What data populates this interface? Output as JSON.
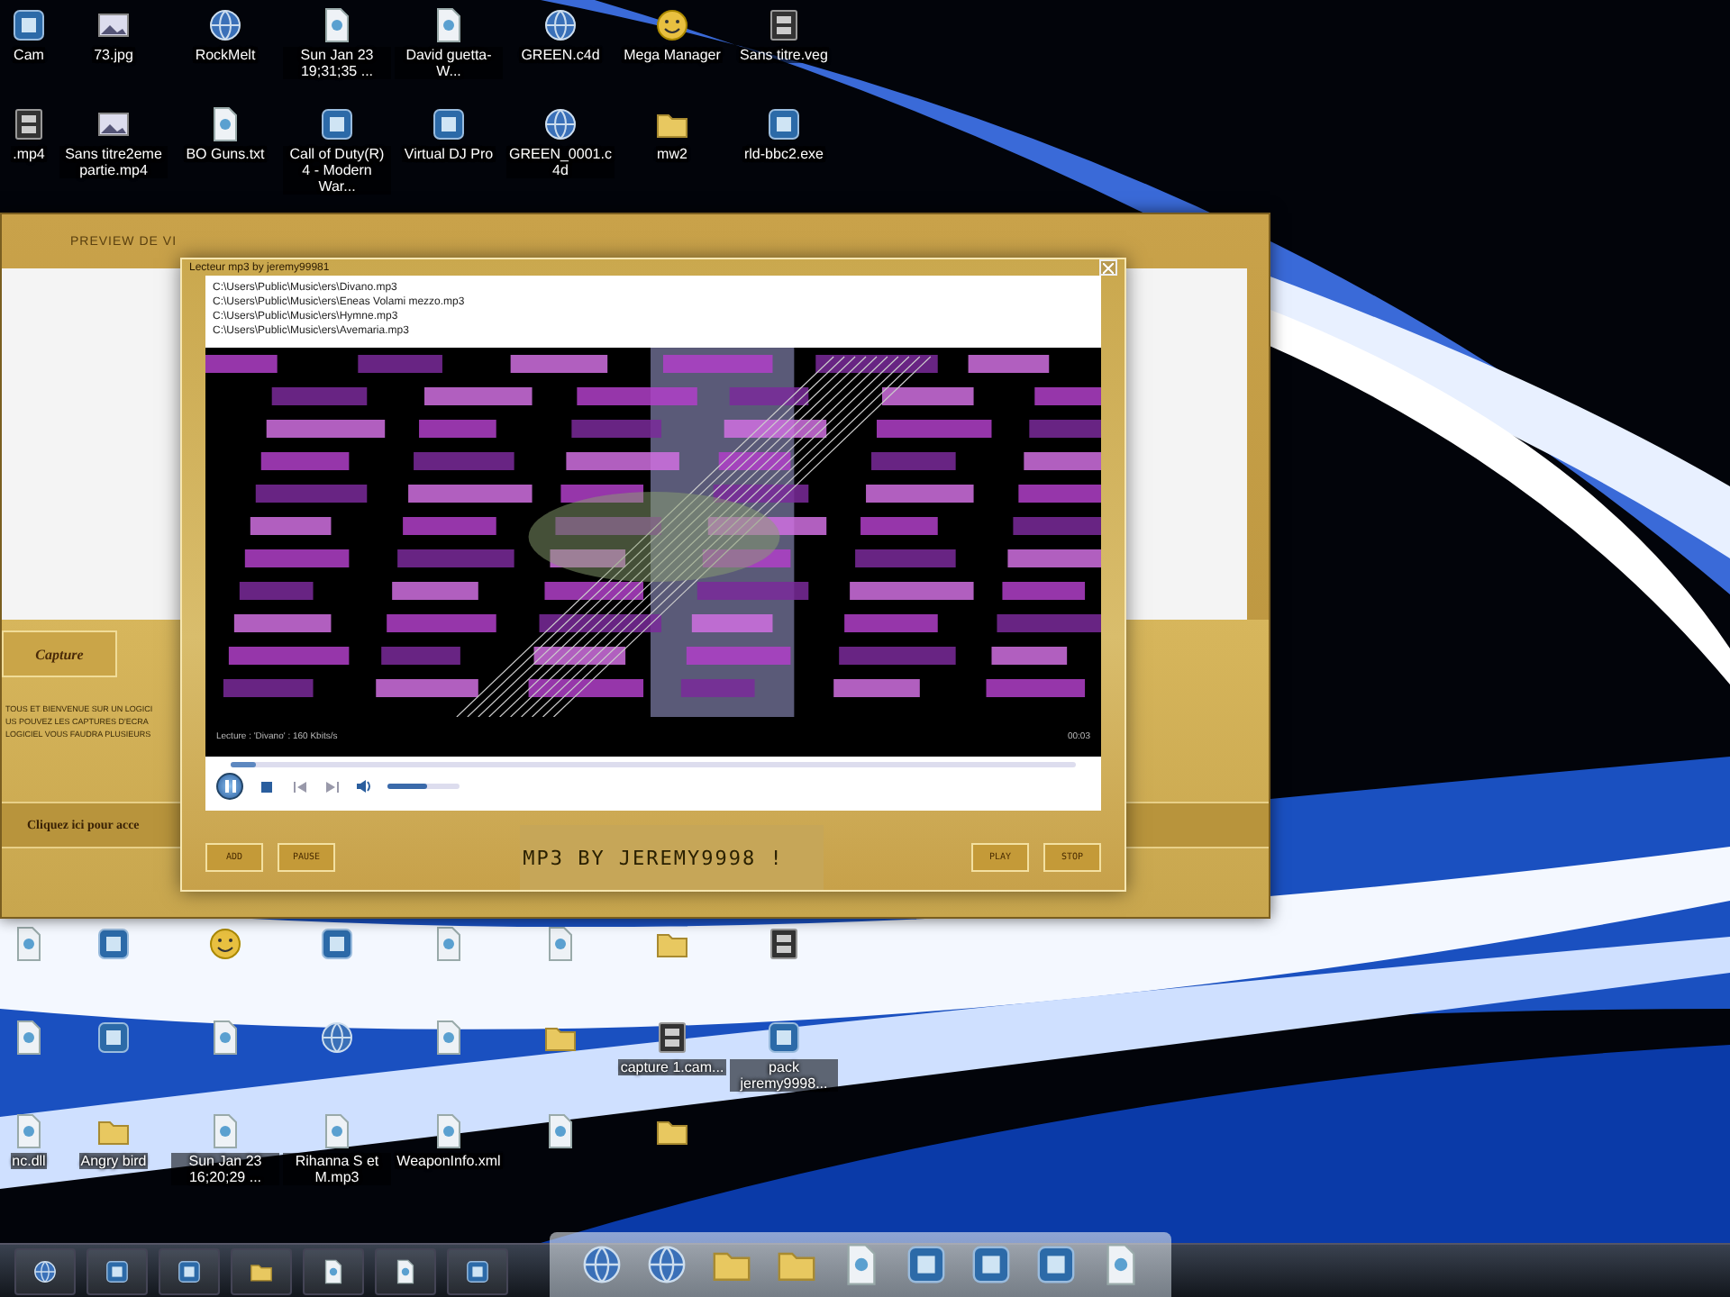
{
  "desktop": {
    "top_icons": [
      {
        "kind": "app",
        "label": "Cam"
      },
      {
        "kind": "image",
        "label": "73.jpg"
      },
      {
        "kind": "globe",
        "label": "RockMelt"
      },
      {
        "kind": "file",
        "label": "Sun Jan 23 19;31;35 ..."
      },
      {
        "kind": "file",
        "label": "David guetta-W..."
      },
      {
        "kind": "globe",
        "label": "GREEN.c4d"
      },
      {
        "kind": "smiley",
        "label": "Mega Manager"
      },
      {
        "kind": "film",
        "label": "Sans titre.veg"
      },
      {
        "kind": "film",
        "label": ".mp4"
      },
      {
        "kind": "image",
        "label": "Sans titre2eme partie.mp4"
      },
      {
        "kind": "file",
        "label": "BO Guns.txt"
      },
      {
        "kind": "app",
        "label": "Call of Duty(R) 4 - Modern War..."
      },
      {
        "kind": "app",
        "label": "Virtual DJ Pro"
      },
      {
        "kind": "globe",
        "label": "GREEN_0001.c4d"
      },
      {
        "kind": "folder",
        "label": "mw2"
      },
      {
        "kind": "app",
        "label": "rld-bbc2.exe"
      }
    ],
    "bottom_icons": [
      {
        "kind": "file"
      },
      {
        "kind": "app"
      },
      {
        "kind": "smiley"
      },
      {
        "kind": "app"
      },
      {
        "kind": "file"
      },
      {
        "kind": "file"
      },
      {
        "kind": "folder"
      },
      {
        "kind": "film"
      },
      {
        "kind": "file"
      },
      {
        "kind": "app"
      },
      {
        "kind": "file"
      },
      {
        "kind": "globe"
      },
      {
        "kind": "file"
      },
      {
        "kind": "folder"
      },
      {
        "kind": "film",
        "label": "capture 1.cam..."
      },
      {
        "kind": "app",
        "label": "pack jeremy9998..."
      },
      {
        "kind": "file",
        "label": "nc.dll"
      },
      {
        "kind": "folder",
        "label": "Angry bird"
      },
      {
        "kind": "file",
        "label": "Sun Jan 23 16;20;29 ..."
      },
      {
        "kind": "file",
        "label": "Rihanna S et M.mp3"
      },
      {
        "kind": "file",
        "label": "WeaponInfo.xml"
      },
      {
        "kind": "file"
      },
      {
        "kind": "folder"
      }
    ]
  },
  "capture_window": {
    "title": "PREVIEW DE VI",
    "button": "Capture",
    "text_lines": [
      "TOUS ET BIENVENUE SUR UN LOGICI",
      "US POUVEZ LES CAPTURES D'ECRA",
      "LOGICIEL VOUS FAUDRA PLUSIEURS"
    ],
    "footer": "Cliquez ici pour acce"
  },
  "player_window": {
    "title": "Lecteur mp3 by jeremy99981",
    "playlist": [
      "C:\\Users\\Public\\Music\\ers\\Divano.mp3",
      "C:\\Users\\Public\\Music\\ers\\Eneas Volami mezzo.mp3",
      "C:\\Users\\Public\\Music\\ers\\Hymne.mp3",
      "C:\\Users\\Public\\Music\\ers\\Avemaria.mp3"
    ],
    "status": "Lecture : 'Divano' : 160 Kbits/s",
    "time": "00:03",
    "playing": true,
    "seek": {
      "level": 0.03
    },
    "volume": {
      "level": 0.55
    },
    "buttons_left": [
      "ADD",
      "PAUSE"
    ],
    "banner": "MP3 BY JEREMY9998 !",
    "buttons_right": [
      "PLAY",
      "STOP"
    ]
  },
  "taskbar": {
    "items": [
      {
        "kind": "globe"
      },
      {
        "kind": "app"
      },
      {
        "kind": "app"
      },
      {
        "kind": "folder"
      },
      {
        "kind": "file"
      },
      {
        "kind": "file"
      },
      {
        "kind": "app"
      }
    ]
  },
  "dock": {
    "items": [
      {
        "kind": "globe"
      },
      {
        "kind": "globe"
      },
      {
        "kind": "folder"
      },
      {
        "kind": "folder"
      },
      {
        "kind": "file"
      },
      {
        "kind": "app"
      },
      {
        "kind": "app"
      },
      {
        "kind": "app"
      },
      {
        "kind": "file"
      }
    ]
  }
}
